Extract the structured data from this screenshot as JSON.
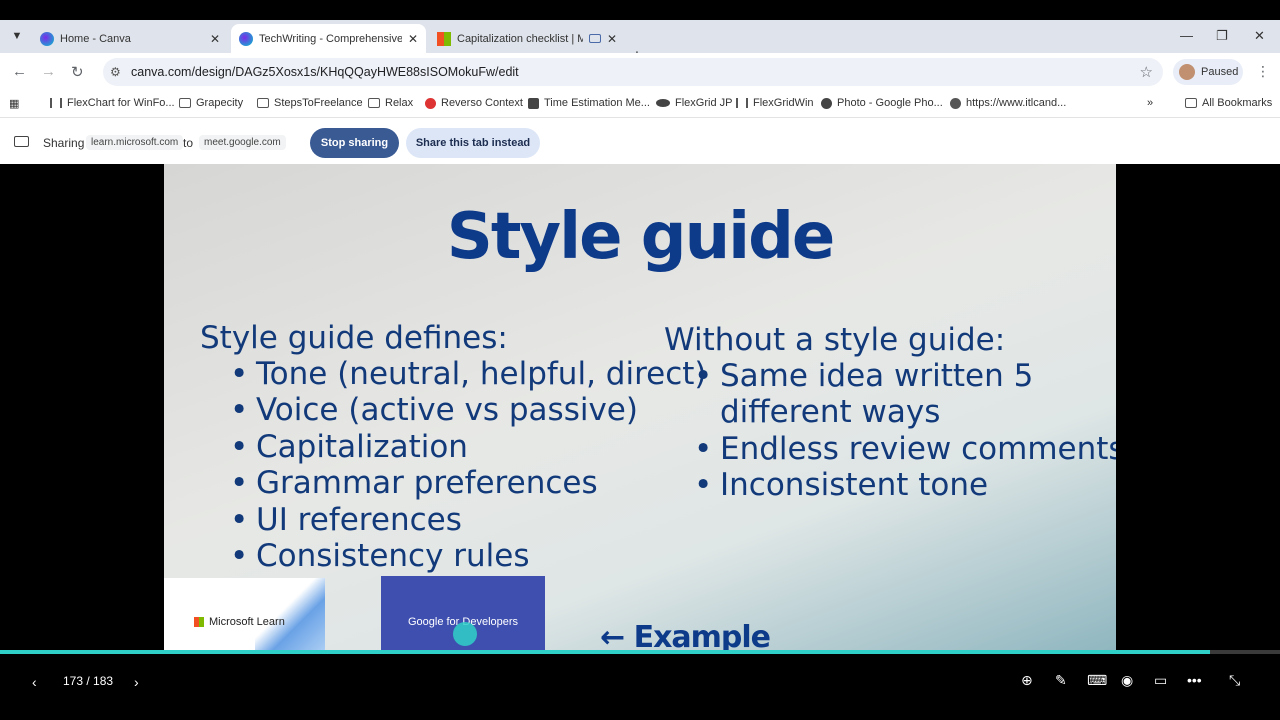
{
  "tabs": [
    {
      "title": "Home - Canva",
      "favicon": "canva-icon",
      "active": false
    },
    {
      "title": "TechWriting - ComprehensiveFo",
      "favicon": "canva-icon",
      "active": true
    },
    {
      "title": "Capitalization checklist | Mi",
      "favicon": "microsoft-icon",
      "active": false
    }
  ],
  "address_bar": {
    "url": "canva.com/design/DAGz5Xosx1s/KHqQQayHWE88sISOMokuFw/edit"
  },
  "profile": {
    "label": "Paused"
  },
  "bookmarks": [
    {
      "label": "FlexChart for WinFo..."
    },
    {
      "label": "Grapecity"
    },
    {
      "label": "StepsToFreelance"
    },
    {
      "label": "Relax"
    },
    {
      "label": "Reverso Context"
    },
    {
      "label": "Time Estimation Me..."
    },
    {
      "label": "FlexGrid JP"
    },
    {
      "label": "FlexGridWin"
    },
    {
      "label": "Photo - Google Pho..."
    },
    {
      "label": "https://www.itlcand..."
    }
  ],
  "all_bookmarks": "All Bookmarks",
  "sharing": {
    "label": "Sharing",
    "from": "learn.microsoft.com",
    "to_word": "to",
    "to": "meet.google.com",
    "stop_label": "Stop sharing",
    "share_tab_label": "Share this tab instead"
  },
  "slide": {
    "title": "Style guide",
    "left_heading": "Style guide defines:",
    "left_items": [
      "Tone (neutral, helpful, direct)",
      "Voice (active vs passive)",
      "Capitalization",
      "Grammar preferences",
      "UI references",
      "Consistency rules"
    ],
    "right_heading": "Without a style guide:",
    "right_items": [
      "Same idea written 5",
      "different ways",
      "Endless review comments",
      "Inconsistent tone"
    ],
    "thumb_ms_label": "Microsoft Learn",
    "thumb_google_label": "Google for Developers",
    "example_label": "← Example"
  },
  "presenter": {
    "counter": "173 / 183",
    "progress": 0.945
  },
  "colors": {
    "title_blue": "#0e3a8a",
    "body_blue": "#123a7a",
    "stop_button": "#3a5a94",
    "progress": "#2fd0c7"
  }
}
